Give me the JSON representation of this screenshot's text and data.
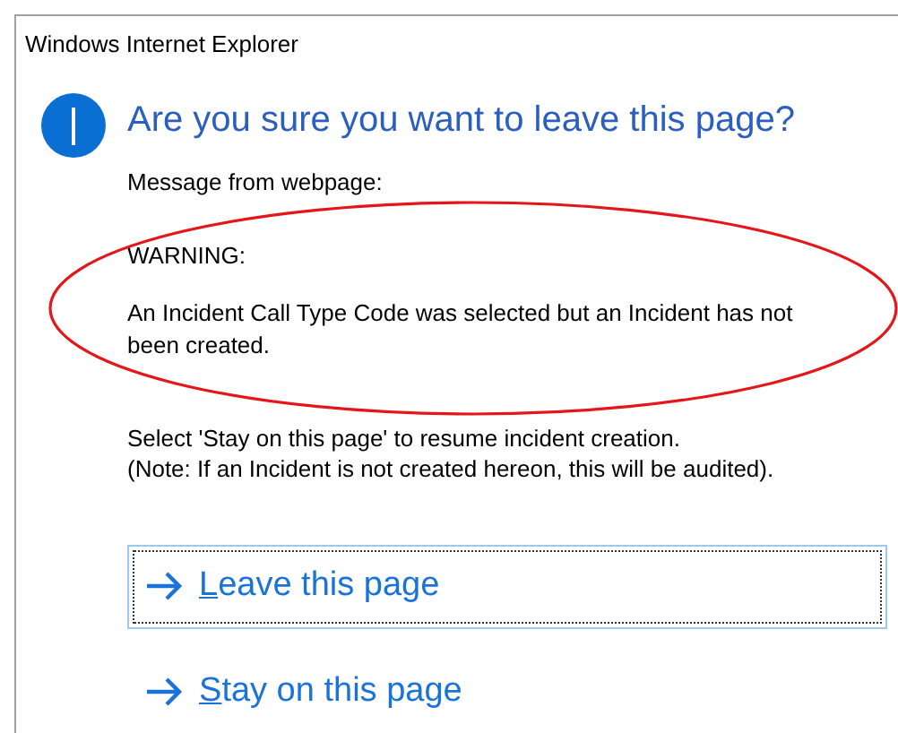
{
  "window": {
    "title": "Windows Internet Explorer"
  },
  "dialog": {
    "heading": "Are you sure you want to leave this page?",
    "source": "Message from webpage:",
    "warning_label": "WARNING:",
    "warning_text": "An Incident Call Type Code was selected but an Incident has not been created.",
    "instruction_lines": [
      "Select 'Stay on this page' to resume incident creation.",
      "(Note: If an Incident is not created hereon, this will be audited)."
    ],
    "commands": [
      {
        "label": "Leave this page",
        "focused": true
      },
      {
        "label": "Stay on this page",
        "focused": false
      }
    ]
  }
}
